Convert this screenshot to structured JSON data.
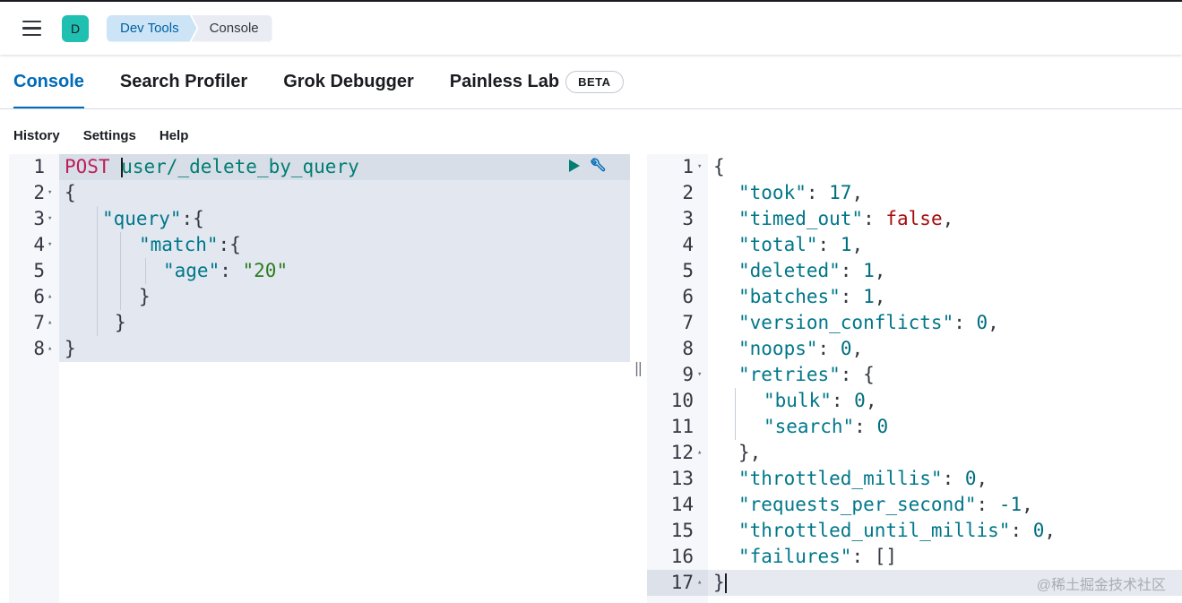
{
  "header": {
    "space_initial": "D",
    "breadcrumbs": [
      "Dev Tools",
      "Console"
    ]
  },
  "tabs": [
    {
      "label": "Console",
      "active": true
    },
    {
      "label": "Search Profiler",
      "active": false
    },
    {
      "label": "Grok Debugger",
      "active": false
    },
    {
      "label": "Painless Lab",
      "active": false,
      "badge": "BETA"
    }
  ],
  "subnav": [
    "History",
    "Settings",
    "Help"
  ],
  "request": {
    "line_numbers": [
      "1",
      "2",
      "3",
      "4",
      "5",
      "6",
      "7",
      "8"
    ],
    "method": "POST",
    "path": "user/_delete_by_query",
    "lines": [
      "{",
      "\"query\"",
      ":{",
      "\"match\"",
      ":{",
      "\"age\"",
      ": ",
      "\"20\"",
      "}",
      "}",
      "}"
    ]
  },
  "response": {
    "line_numbers": [
      "1",
      "2",
      "3",
      "4",
      "5",
      "6",
      "7",
      "8",
      "9",
      "10",
      "11",
      "12",
      "13",
      "14",
      "15",
      "16",
      "17"
    ],
    "keys": {
      "took": "\"took\"",
      "took_val": "17",
      "timed_out": "\"timed_out\"",
      "timed_out_val": "false",
      "total": "\"total\"",
      "total_val": "1",
      "deleted": "\"deleted\"",
      "deleted_val": "1",
      "batches": "\"batches\"",
      "batches_val": "1",
      "version_conflicts": "\"version_conflicts\"",
      "version_conflicts_val": "0",
      "noops": "\"noops\"",
      "noops_val": "0",
      "retries": "\"retries\"",
      "bulk": "\"bulk\"",
      "bulk_val": "0",
      "search": "\"search\"",
      "search_val": "0",
      "throttled_millis": "\"throttled_millis\"",
      "throttled_millis_val": "0",
      "requests_per_second": "\"requests_per_second\"",
      "requests_per_second_val": "-1",
      "throttled_until_millis": "\"throttled_until_millis\"",
      "throttled_until_millis_val": "0",
      "failures": "\"failures\"",
      "failures_val": "[]"
    }
  },
  "watermark": "@稀土掘金技术社区",
  "colors": {
    "accent": "#006bb8",
    "method": "#bd1f57",
    "path": "#017d73",
    "string_value": "#2a7d20",
    "number": "#006e80",
    "boolean": "#a50d0d"
  }
}
